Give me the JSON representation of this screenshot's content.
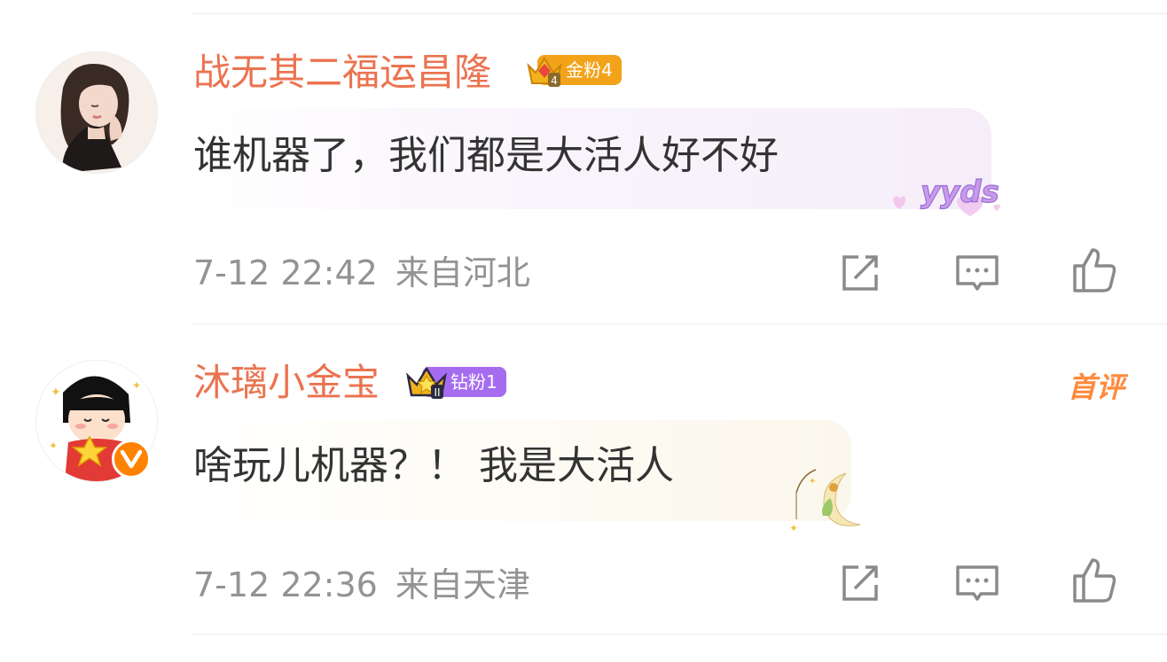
{
  "comments": [
    {
      "username": "战无其二福运昌隆",
      "fan_badge": {
        "label": "金粉4",
        "level": "4",
        "color": "#f2a31a"
      },
      "text": "谁机器了，我们都是大活人好不好",
      "bubble_sticker": "yyds",
      "time": "7-12 22:42",
      "location": "来自河北",
      "actions": [
        "share-icon",
        "comment-icon",
        "like-icon"
      ]
    },
    {
      "username": "沐璃小金宝",
      "fan_badge": {
        "label": "钻粉1",
        "level": "II",
        "color": "#a66cf0"
      },
      "verified_icon": "v-verified-icon",
      "first_comment_tag": "首评",
      "text": "啥玩儿机器？！ 我是大活人",
      "bubble_sticker": "little-prince-moon-icon",
      "time": "7-12 22:36",
      "location": "来自天津",
      "actions": [
        "share-icon",
        "comment-icon",
        "like-icon"
      ]
    }
  ],
  "colors": {
    "username": "#eb7350",
    "meta": "#939393",
    "text": "#333333",
    "icon": "#8a8a8a",
    "verified": "#ff8200"
  }
}
